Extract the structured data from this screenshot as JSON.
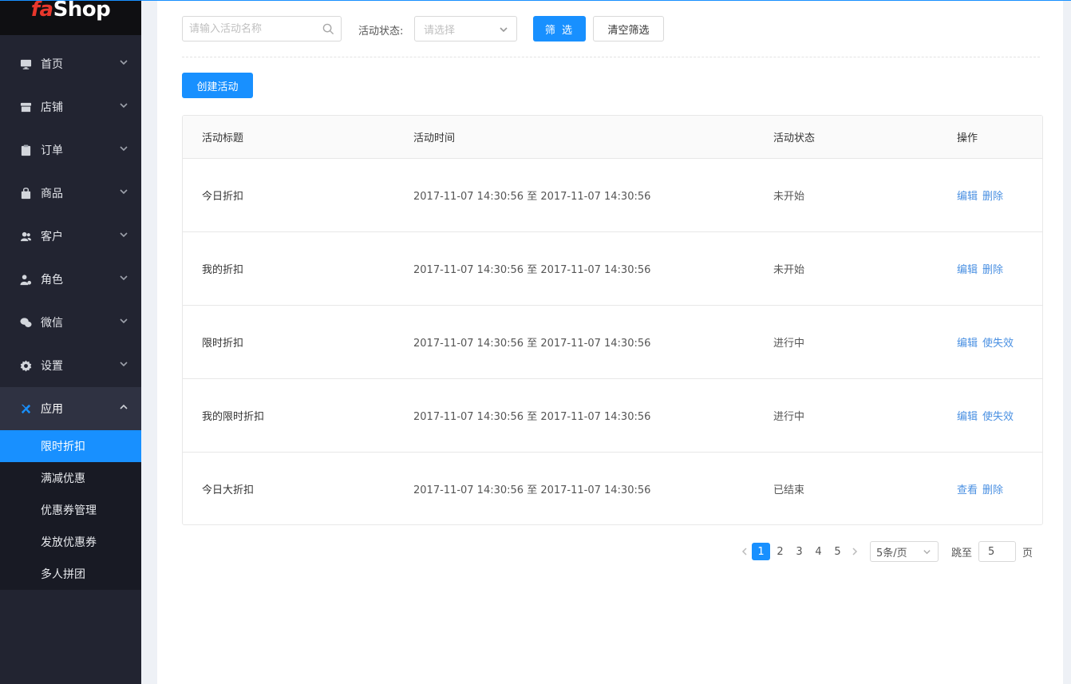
{
  "brand": {
    "logo_part1": "fa",
    "logo_part2": "Shop",
    "accent_color": "#1890ff",
    "logo_red": "#e8372c"
  },
  "sidebar": {
    "items": [
      {
        "label": "首页",
        "icon": "monitor-icon"
      },
      {
        "label": "店铺",
        "icon": "store-icon"
      },
      {
        "label": "订单",
        "icon": "clipboard-icon"
      },
      {
        "label": "商品",
        "icon": "bag-icon"
      },
      {
        "label": "客户",
        "icon": "users-icon"
      },
      {
        "label": "角色",
        "icon": "user-gear-icon"
      },
      {
        "label": "微信",
        "icon": "wechat-icon"
      },
      {
        "label": "设置",
        "icon": "gear-icon"
      },
      {
        "label": "应用",
        "icon": "apps-icon",
        "open": true
      }
    ],
    "submenu": [
      {
        "label": "限时折扣",
        "active": true
      },
      {
        "label": "满减优惠"
      },
      {
        "label": "优惠券管理"
      },
      {
        "label": "发放优惠券"
      },
      {
        "label": "多人拼团"
      }
    ]
  },
  "filters": {
    "search_placeholder": "请输入活动名称",
    "status_label": "活动状态:",
    "status_placeholder": "请选择",
    "filter_button": "筛 选",
    "clear_button": "清空筛选"
  },
  "create_button": "创建活动",
  "table": {
    "headers": [
      "活动标题",
      "活动时间",
      "活动状态",
      "操作"
    ],
    "rows": [
      {
        "title": "今日折扣",
        "time": "2017-11-07 14:30:56 至 2017-11-07 14:30:56",
        "status": "未开始",
        "actions": [
          "编辑",
          "删除"
        ]
      },
      {
        "title": "我的折扣",
        "time": "2017-11-07 14:30:56 至 2017-11-07 14:30:56",
        "status": "未开始",
        "actions": [
          "编辑",
          "删除"
        ]
      },
      {
        "title": "限时折扣",
        "time": "2017-11-07 14:30:56 至 2017-11-07 14:30:56",
        "status": "进行中",
        "actions": [
          "编辑",
          "使失效"
        ]
      },
      {
        "title": "我的限时折扣",
        "time": "2017-11-07 14:30:56 至 2017-11-07 14:30:56",
        "status": "进行中",
        "actions": [
          "编辑",
          "使失效"
        ]
      },
      {
        "title": "今日大折扣",
        "time": "2017-11-07 14:30:56 至 2017-11-07 14:30:56",
        "status": "已结束",
        "actions": [
          "查看",
          "删除"
        ]
      }
    ]
  },
  "pagination": {
    "pages": [
      "1",
      "2",
      "3",
      "4",
      "5"
    ],
    "current": "1",
    "page_size": "5条/页",
    "jump_label": "跳至",
    "jump_value": "5",
    "page_suffix": "页"
  }
}
